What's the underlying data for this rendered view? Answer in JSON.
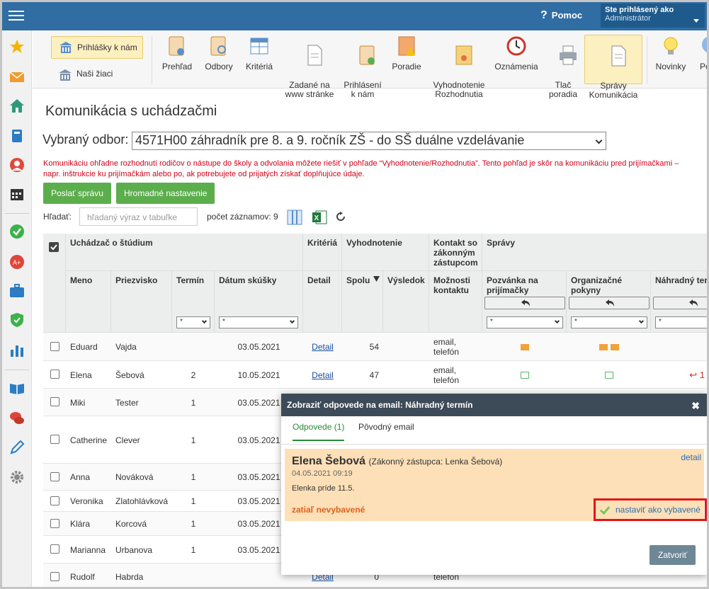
{
  "header": {
    "help_label": "Pomoc",
    "user_title": "Ste prihlásený ako",
    "user_name": "Administrátor"
  },
  "toolbar": {
    "left_primary": "Prihlášky k nám",
    "left_secondary": "Naši žiaci",
    "items": [
      {
        "label": "Prehľad"
      },
      {
        "label": "Odbory"
      },
      {
        "label": "Kritériá"
      },
      {
        "label": "Zadané na\nwww stránke"
      },
      {
        "label": "Prihlásení\nk nám"
      },
      {
        "label": "Poradie"
      },
      {
        "label": "Vyhodnotenie\nRozhodnutia"
      },
      {
        "label": "Oznámenia"
      },
      {
        "label": "Tlač\nporadia"
      },
      {
        "label": "Správy\nKomunikácia"
      },
      {
        "label": "Novinky"
      },
      {
        "label": "Po"
      }
    ]
  },
  "page": {
    "title": "Komunikácia s uchádzačmi",
    "odbor_label": "Vybraný odbor:",
    "odbor_value": "4571H00 záhradník pre 8. a 9. ročník ZŠ - do SŠ duálne vzdelávanie",
    "note": "Komunikáciu ohľadne rozhodnutí rodičov o nástupe do školy a odvolania môžete riešiť v pohľade “Vyhodnotenie/Rozhodnutia”. Tento pohľad je skôr na komunikáciu pred prijímačkami – napr. inštrukcie ku prijímačkám alebo po, ak potrebujete od prijatých získať doplňujúce údaje.",
    "btn_send": "Poslať správu",
    "btn_bulk": "Hromadné nastavenie",
    "search_label": "Hľadať:",
    "search_placeholder": "hľadaný výraz v tabuľke",
    "count_label": "počet záznamov: 9"
  },
  "table": {
    "group_headers": {
      "applicant": "Uchádzač o štúdium",
      "criteria": "Kritériá",
      "evaluation": "Vyhodnotenie",
      "contact": "Kontakt so zákonným zástupcom",
      "messages": "Správy"
    },
    "columns": {
      "first": "Meno",
      "last": "Priezvisko",
      "term": "Termín",
      "date": "Dátum skúšky",
      "detail": "Detail",
      "total": "Spolu",
      "result": "Výsledok",
      "contact": "Možnosti kontaktu",
      "invite": "Pozvánka na prijímačky",
      "org": "Organizačné pokyny",
      "alt": "Náhradný ter"
    },
    "filter_star": "*",
    "rows": [
      {
        "first": "Eduard",
        "last": "Vajda",
        "term": "",
        "date": "03.05.2021",
        "detail": "Detail",
        "total": "54",
        "contact": "email, telefón",
        "invite": "env",
        "org": "env2",
        "alt": ""
      },
      {
        "first": "Elena",
        "last": "Šebová",
        "term": "2",
        "date": "10.05.2021",
        "detail": "Detail",
        "total": "47",
        "contact": "email, telefón",
        "invite": "open",
        "org": "open",
        "alt": "1"
      },
      {
        "first": "Miki",
        "last": "Tester",
        "term": "1",
        "date": "03.05.2021",
        "detail": "",
        "total": "",
        "contact": "",
        "invite": "",
        "org": "",
        "alt": ""
      },
      {
        "first": "Catherine",
        "last": "Clever",
        "term": "1",
        "date": "03.05.2021",
        "detail": "",
        "total": "",
        "contact": "",
        "invite": "",
        "org": "",
        "alt": ""
      },
      {
        "first": "Anna",
        "last": "Nováková",
        "term": "1",
        "date": "03.05.2021",
        "detail": "",
        "total": "",
        "contact": "",
        "invite": "",
        "org": "",
        "alt": ""
      },
      {
        "first": "Veronika",
        "last": "Zlatohlávková",
        "term": "1",
        "date": "03.05.2021",
        "detail": "",
        "total": "",
        "contact": "",
        "invite": "",
        "org": "",
        "alt": ""
      },
      {
        "first": "Klára",
        "last": "Korcová",
        "term": "1",
        "date": "03.05.2021",
        "detail": "",
        "total": "",
        "contact": "",
        "invite": "",
        "org": "",
        "alt": ""
      },
      {
        "first": "Marianna",
        "last": "Urbanova",
        "term": "1",
        "date": "03.05.2021",
        "detail": "",
        "total": "",
        "contact": "",
        "invite": "",
        "org": "",
        "alt": ""
      },
      {
        "first": "Rudolf",
        "last": "Habrda",
        "term": "",
        "date": "",
        "detail": "Detail",
        "total": "0",
        "contact": "telefón",
        "invite": "",
        "org": "",
        "alt": ""
      }
    ]
  },
  "dialog": {
    "title": "Zobraziť odpovede na email: Náhradný termín",
    "tab_replies": "Odpovede (1)",
    "tab_original": "Pôvodný email",
    "sender_name": "Elena Šebová",
    "sender_rep": "(Zákonný zástupca: Lenka Šebová)",
    "date": "04.05.2021 09:19",
    "message": "Elenka príde 11.5.",
    "status": "zatiaľ nevybavené",
    "detail_link": "detail",
    "set_done": "nastaviť ako vybavené",
    "close": "Zatvoriť"
  },
  "colors": {
    "topbar": "#2f6da3",
    "green": "#5cae4c",
    "warn": "#d0021b",
    "highlight": "#e0161b",
    "card": "#fde0b8"
  }
}
